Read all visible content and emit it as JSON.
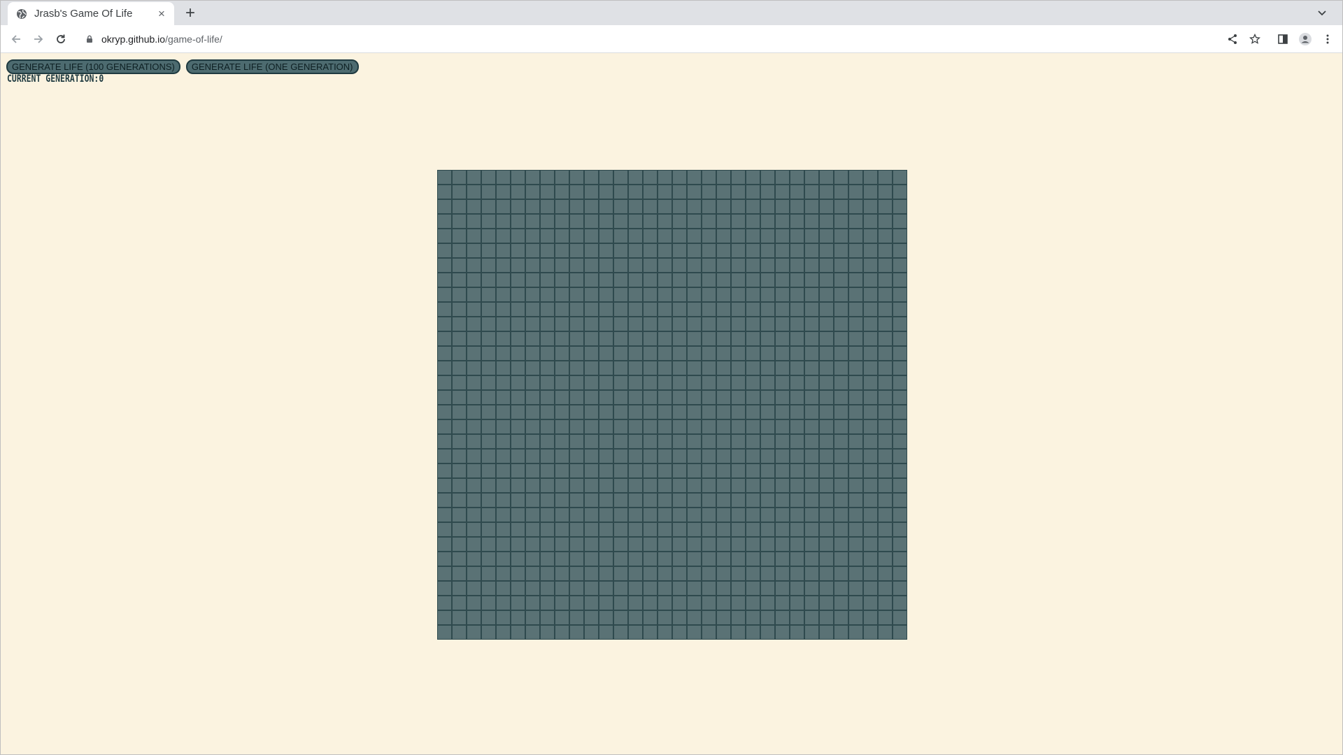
{
  "browser": {
    "tab_title": "Jrasb's Game Of Life",
    "url_host": "okryp.github.io",
    "url_path": "/game-of-life/"
  },
  "game": {
    "button_100": "GENERATE LIFE (100 GENERATIONS)",
    "button_one": "GENERATE LIFE (ONE GENERATION)",
    "generation_label": "CURRENT GENERATION:",
    "generation_value": "0",
    "grid_columns": 32,
    "grid_rows": 32,
    "live_cells": 0
  },
  "colors": {
    "page_background": "#fbf3e0",
    "dead_cell": "#5a7275",
    "grid_line": "#2f4a4e",
    "button_fill": "#4d6b70"
  },
  "icons": {
    "tab": "globe-icon",
    "close": "close-icon",
    "new_tab": "plus-icon",
    "back": "back-arrow-icon",
    "forward": "forward-arrow-icon",
    "reload": "reload-icon",
    "lock": "lock-icon",
    "share": "share-icon",
    "bookmark": "star-icon",
    "side_panel": "side-panel-icon",
    "profile": "profile-icon",
    "menu": "kebab-menu-icon",
    "tab_search": "chevron-down-icon"
  }
}
